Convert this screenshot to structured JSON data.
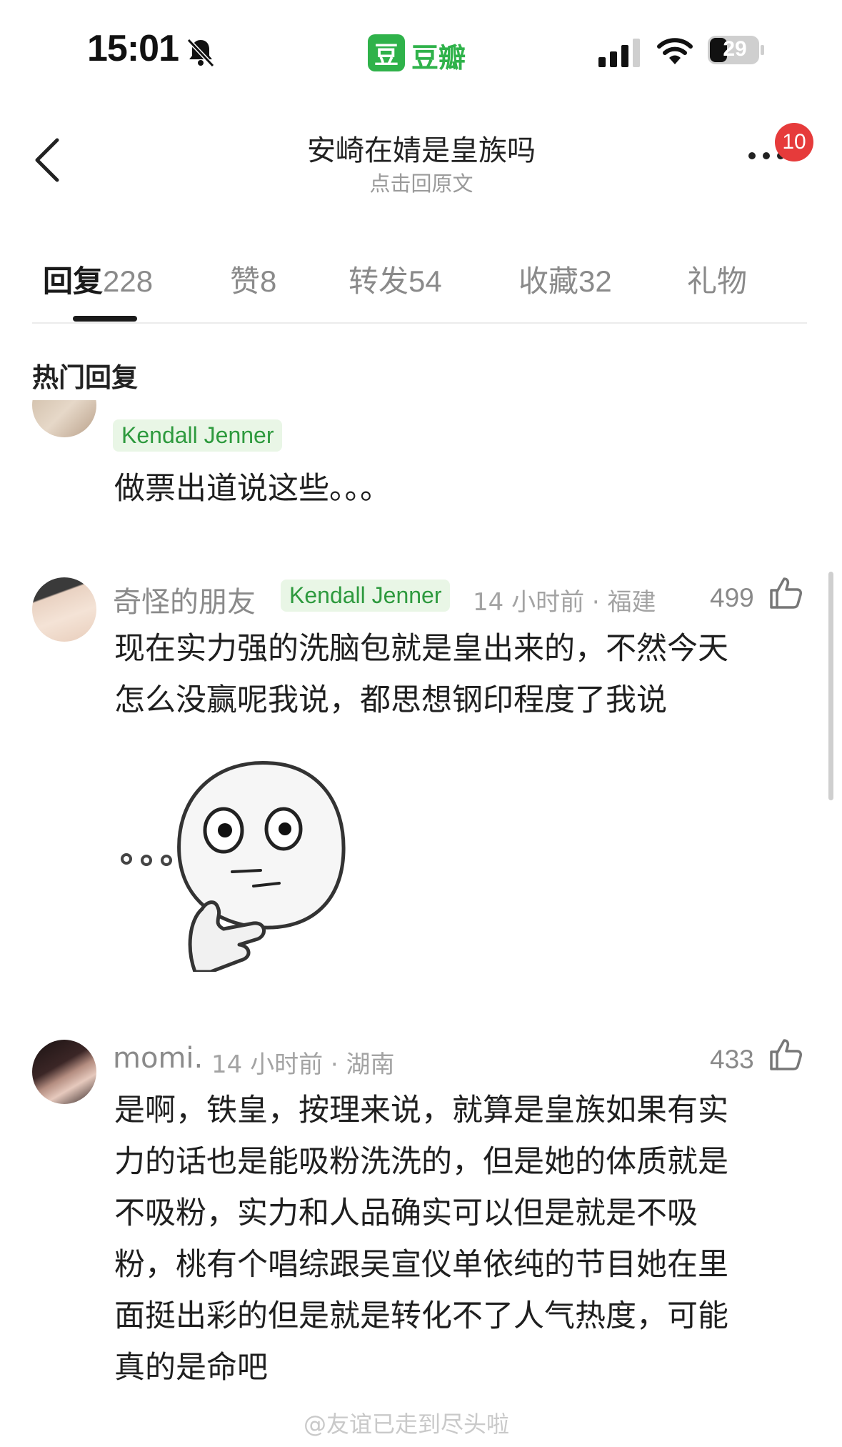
{
  "status_bar": {
    "time": "15:01",
    "app_badge": "豆",
    "app_name": "豆瓣",
    "battery": "29"
  },
  "nav": {
    "title": "安崎在婧是皇族吗",
    "subtitle": "点击回原文",
    "notification_count": "10"
  },
  "tabs": [
    {
      "label": "回复",
      "count": "228"
    },
    {
      "label": "赞",
      "count": "8"
    },
    {
      "label": "转发",
      "count": "54"
    },
    {
      "label": "收藏",
      "count": "32"
    },
    {
      "label": "礼物",
      "count": ""
    }
  ],
  "section_title": "热门回复",
  "comments": [
    {
      "tag": "Kendall Jenner",
      "text": "做票出道说这些。。。"
    },
    {
      "username": "奇怪的朋友",
      "tag": "Kendall Jenner",
      "time": "14 小时前",
      "location": "福建",
      "likes": "499",
      "text_lines": [
        "现在实力强的洗脑包就是皇出来的，不然今天",
        "怎么没赢呢我说，都思想钢印程度了我说"
      ]
    },
    {
      "username": "momi.",
      "time": "14 小时前",
      "location": "湖南",
      "likes": "433",
      "text_lines": [
        "是啊，铁皇，按理来说，就算是皇族如果有实",
        "力的话也是能吸粉洗洗的，但是她的体质就是",
        "不吸粉，实力和人品确实可以但是就是不吸",
        "粉，桃有个唱综跟吴宣仪单依纯的节目她在里",
        "面挺出彩的但是就是转化不了人气热度，可能",
        "真的是命吧"
      ]
    }
  ],
  "watermark": "@友谊已走到尽头啦",
  "icons": {
    "bell": "bell-muted-icon",
    "signal": "signal-icon",
    "wifi": "wifi-icon",
    "battery": "battery-icon",
    "back": "back-arrow-icon",
    "more": "more-icon",
    "like": "thumbs-up-icon"
  },
  "colors": {
    "brand_green": "#2fb24a",
    "tag_green": "#2e9a3e",
    "notification_red": "#e63b3b"
  }
}
